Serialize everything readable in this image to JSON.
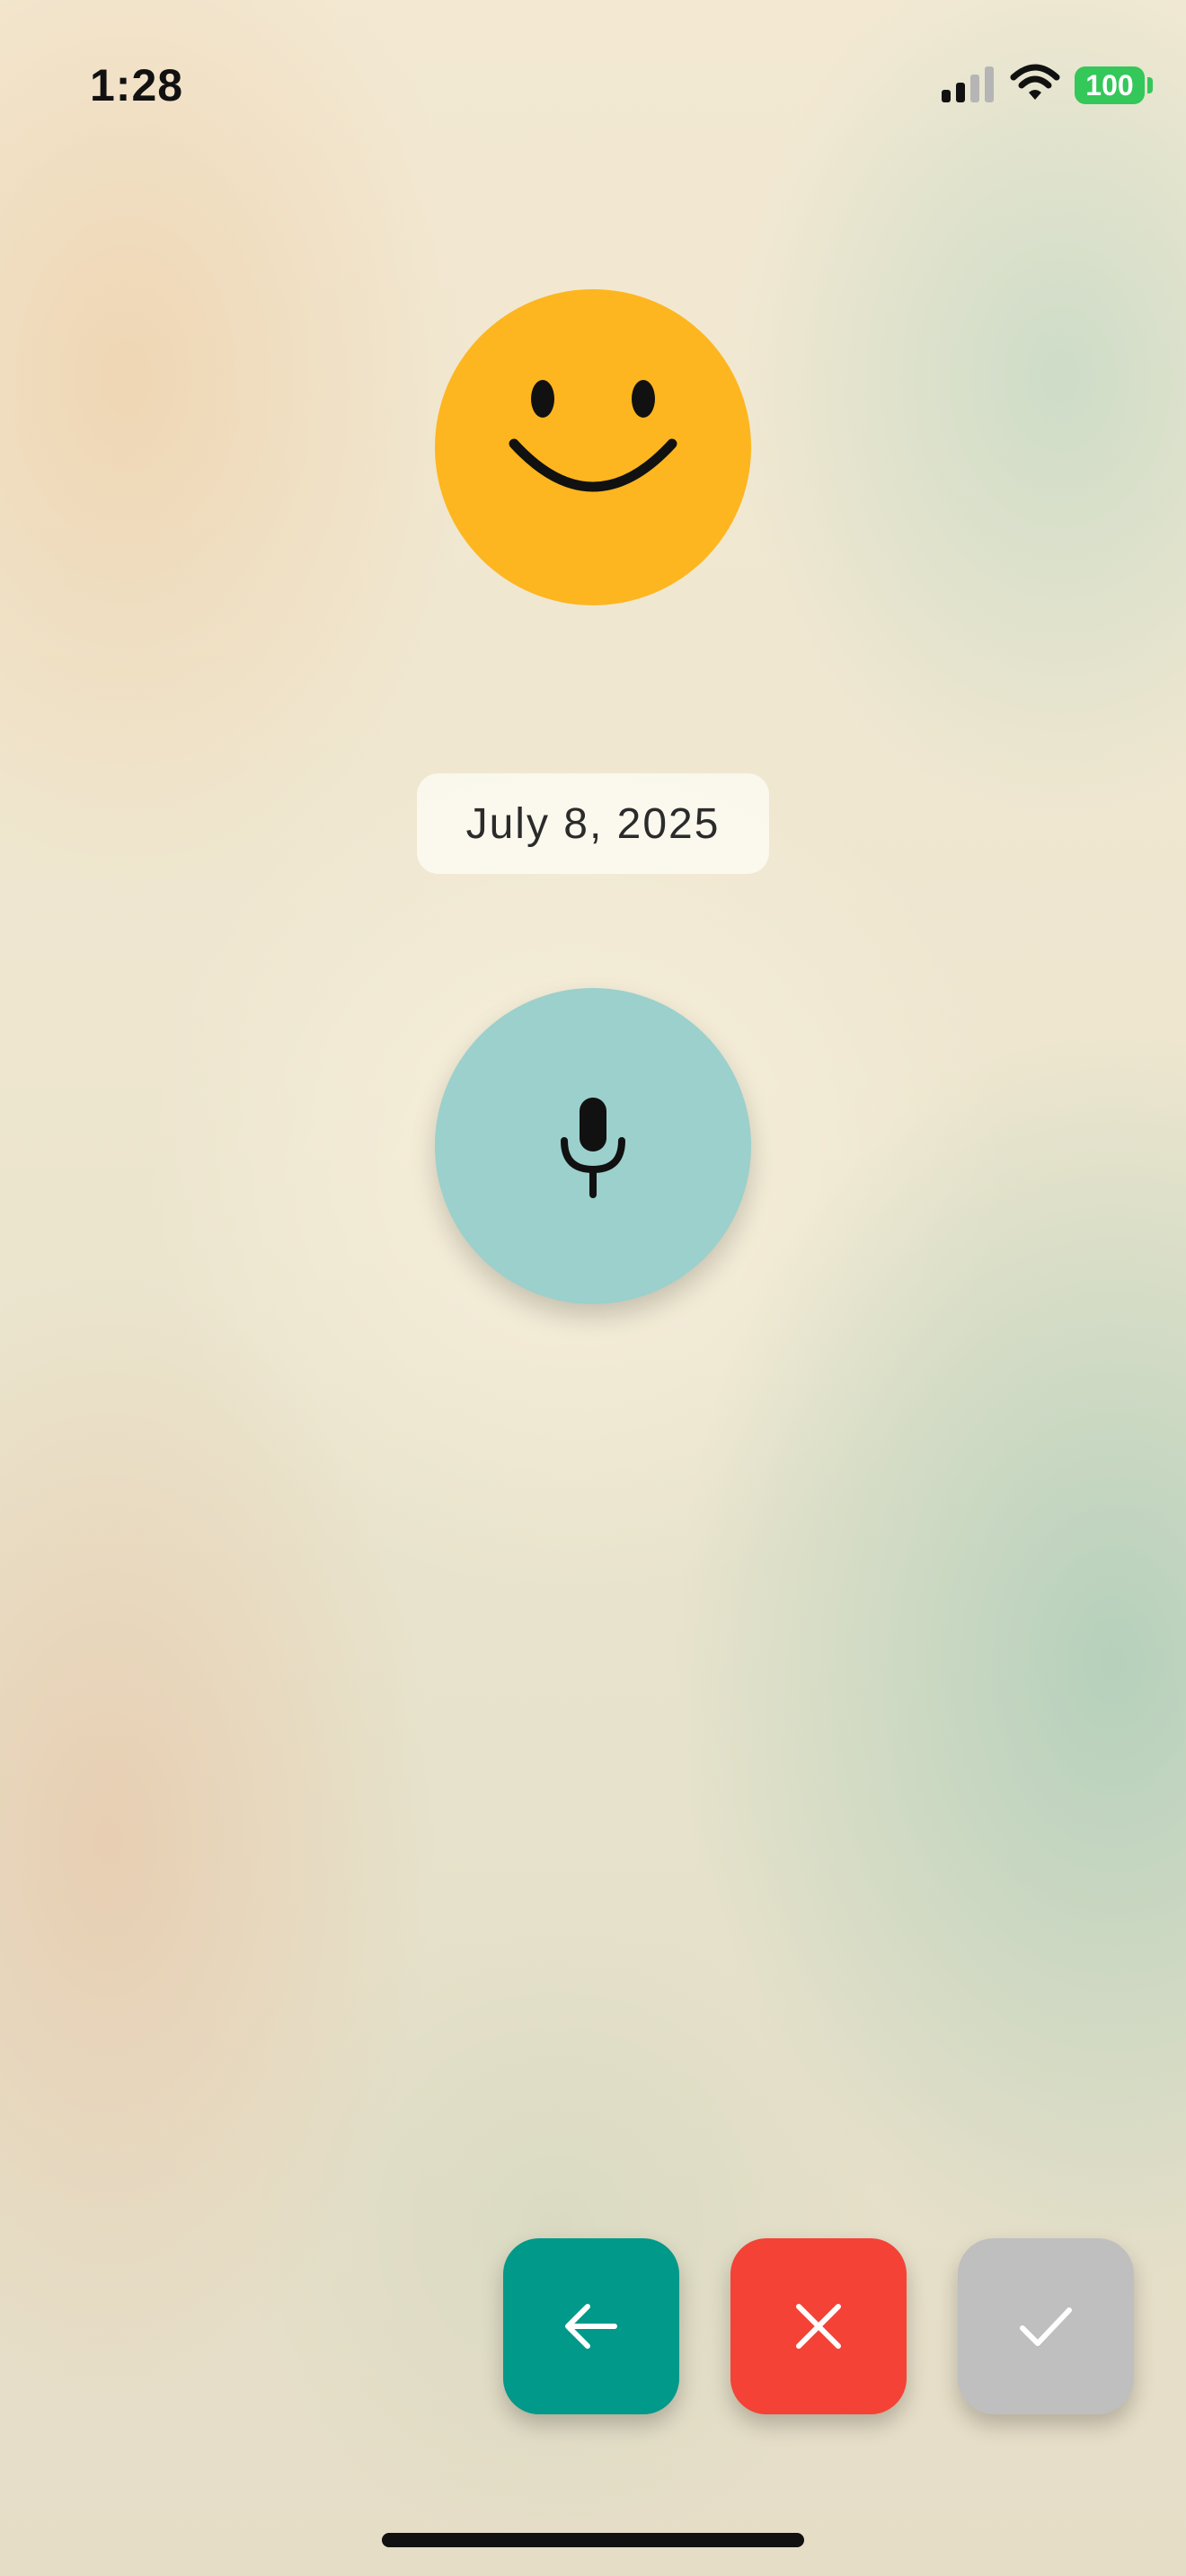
{
  "status_bar": {
    "time": "1:28",
    "battery_level": "100",
    "icons": [
      "signal-icon",
      "wifi-icon",
      "battery-icon"
    ],
    "battery_color": "#34c759"
  },
  "mood": {
    "icon": "smiley-face-icon",
    "color": "#fdb61f"
  },
  "entry": {
    "date": "July 8, 2025"
  },
  "mic": {
    "icon": "microphone-icon",
    "color": "#9bd0cc"
  },
  "actions": [
    {
      "name": "back",
      "icon": "arrow-left-icon",
      "color": "#00998a"
    },
    {
      "name": "cancel",
      "icon": "close-icon",
      "color": "#f44236"
    },
    {
      "name": "confirm",
      "icon": "checkmark-icon",
      "color": "#bfbfbf"
    }
  ]
}
